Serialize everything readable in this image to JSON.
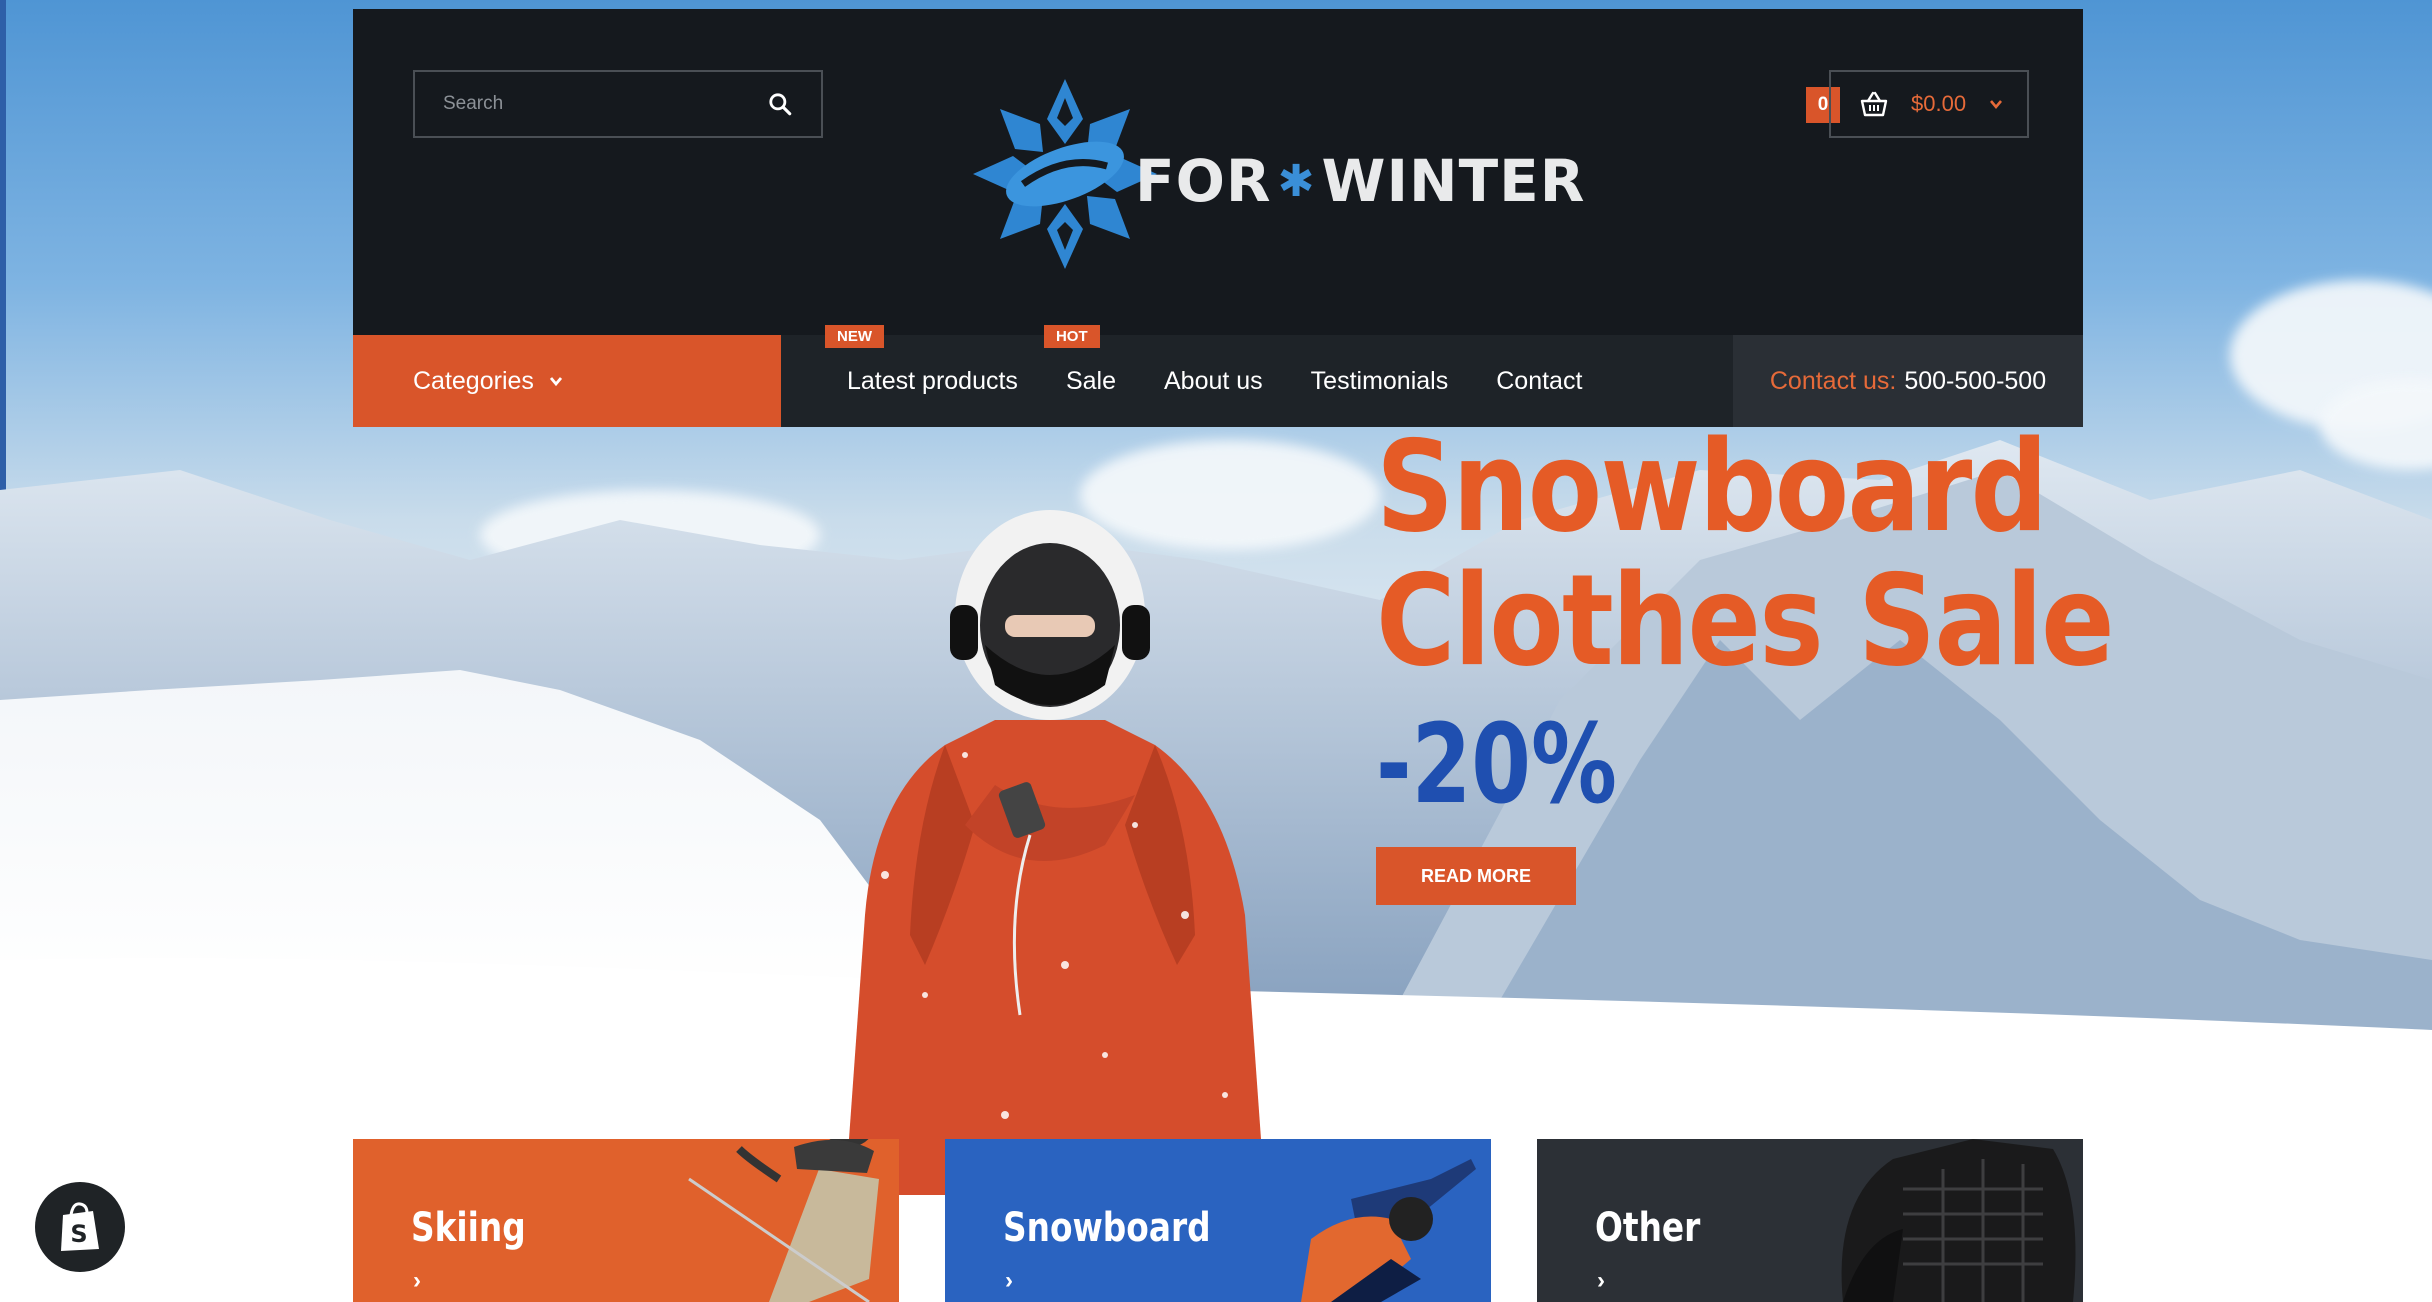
{
  "header": {
    "search_placeholder": "Search",
    "logo": {
      "text_left": "FOR",
      "text_right": "WINTER",
      "star": "✱"
    },
    "cart": {
      "count": "0",
      "total": "$0.00"
    }
  },
  "nav": {
    "categories_label": "Categories",
    "links": [
      {
        "label": "Latest products",
        "badge": "NEW"
      },
      {
        "label": "Sale",
        "badge": "HOT"
      },
      {
        "label": "About us",
        "badge": ""
      },
      {
        "label": "Testimonials",
        "badge": ""
      },
      {
        "label": "Contact",
        "badge": ""
      }
    ],
    "contact_label": "Contact us:",
    "contact_number": "500-500-500"
  },
  "hero": {
    "line1": "Snowboard",
    "line2": "Clothes Sale",
    "discount": "-20%",
    "button": "READ MORE"
  },
  "tiles": [
    {
      "label": "Skiing",
      "arrow": "›",
      "color": "#e0612c"
    },
    {
      "label": "Snowboard",
      "arrow": "›",
      "color": "#2a63c0"
    },
    {
      "label": "Other",
      "arrow": "›",
      "color": "#2c3036"
    }
  ],
  "colors": {
    "accent": "#d9552a",
    "dark": "#15191e",
    "blue": "#1f4fb0"
  },
  "icons": [
    "search-icon",
    "basket-icon",
    "chevron-down-icon",
    "shopify-icon",
    "snowflake-logo-icon"
  ]
}
